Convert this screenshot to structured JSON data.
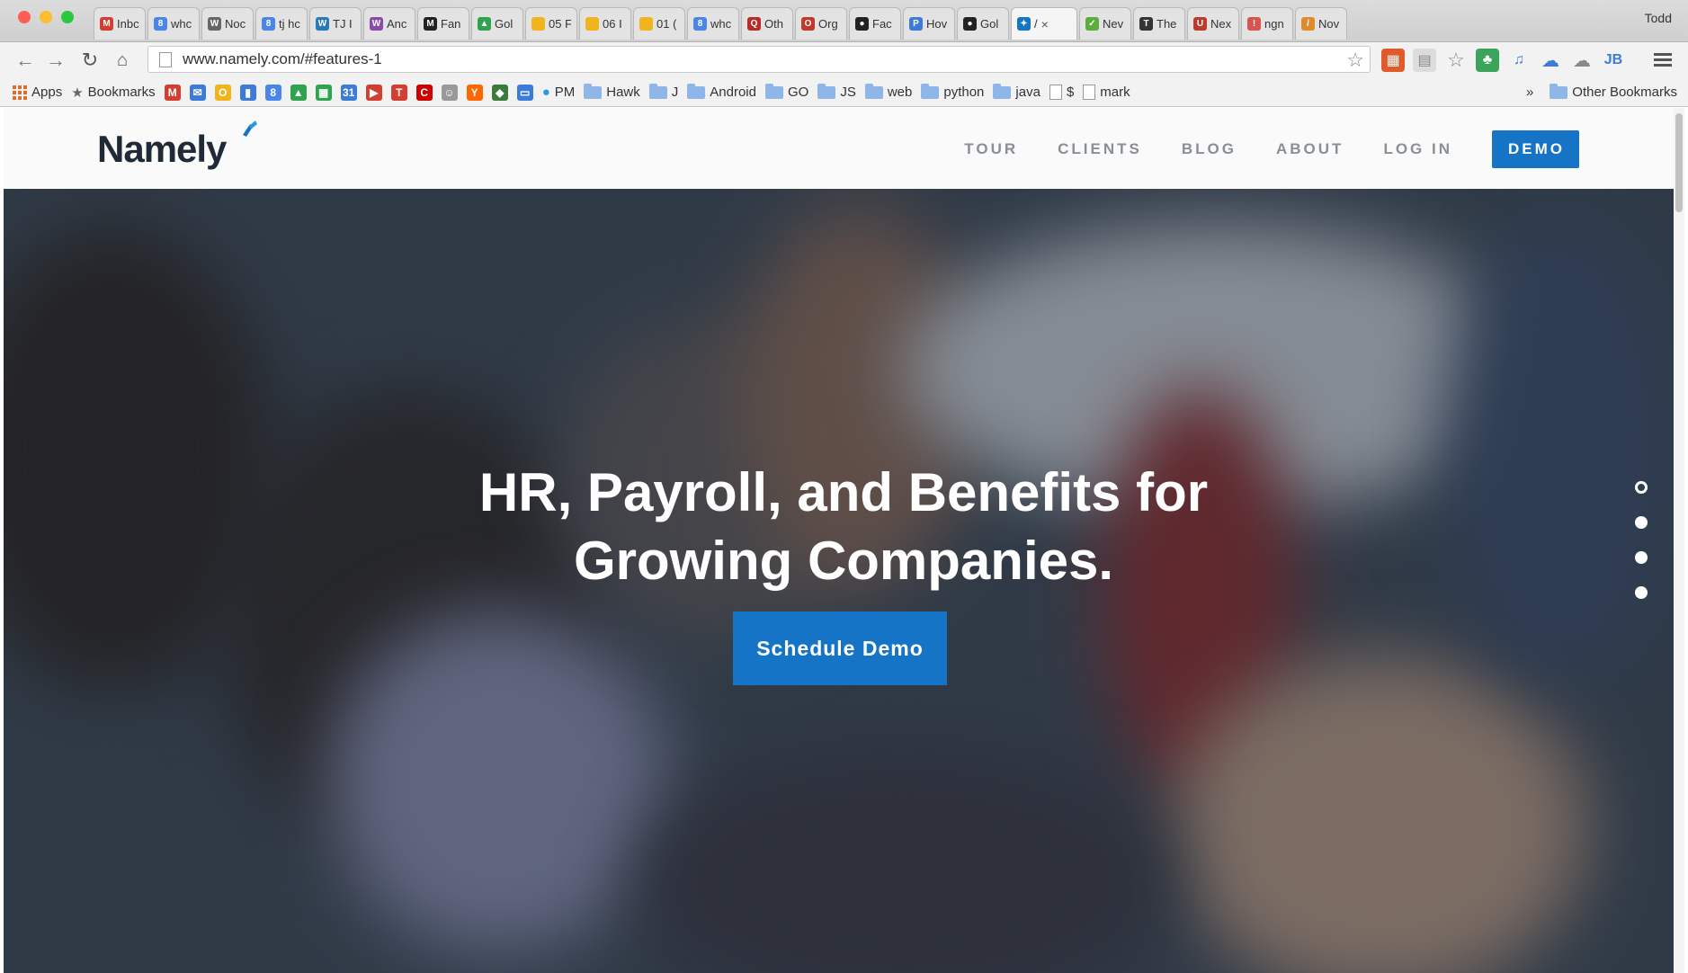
{
  "browser": {
    "profile_name": "Todd",
    "tabs": [
      {
        "title": "Inbc",
        "icon": "gmail-icon",
        "color": "#d23f31",
        "glyph": "M"
      },
      {
        "title": "whc",
        "icon": "google-icon",
        "color": "#4a86e8",
        "glyph": "8"
      },
      {
        "title": "Noc",
        "icon": "wikipedia-icon",
        "color": "#666666",
        "glyph": "W"
      },
      {
        "title": "tj hc",
        "icon": "google-icon",
        "color": "#4a86e8",
        "glyph": "8"
      },
      {
        "title": "TJ I",
        "icon": "web-icon",
        "color": "#2a7ab8",
        "glyph": "W"
      },
      {
        "title": "Anc",
        "icon": "wordpress-icon",
        "color": "#8a4aa8",
        "glyph": "W"
      },
      {
        "title": "Fan",
        "icon": "site-icon",
        "color": "#222222",
        "glyph": "M"
      },
      {
        "title": "Gol",
        "icon": "drive-icon",
        "color": "#2ea44f",
        "glyph": "▲"
      },
      {
        "title": "05 F",
        "icon": "doc-icon",
        "color": "#f0b41e",
        "glyph": ""
      },
      {
        "title": "06 I",
        "icon": "doc-icon",
        "color": "#f0b41e",
        "glyph": ""
      },
      {
        "title": "01 (",
        "icon": "doc-icon",
        "color": "#f0b41e",
        "glyph": ""
      },
      {
        "title": "whc",
        "icon": "google-icon",
        "color": "#4a86e8",
        "glyph": "8"
      },
      {
        "title": "Oth",
        "icon": "quora-icon",
        "color": "#b92b27",
        "glyph": "Q"
      },
      {
        "title": "Org",
        "icon": "site-icon",
        "color": "#c0392b",
        "glyph": "O"
      },
      {
        "title": "Fac",
        "icon": "github-icon",
        "color": "#222222",
        "glyph": "●"
      },
      {
        "title": "Hov",
        "icon": "site-icon",
        "color": "#3d7bd9",
        "glyph": "P"
      },
      {
        "title": "Gol",
        "icon": "github-icon",
        "color": "#222222",
        "glyph": "●"
      },
      {
        "title": "/",
        "icon": "namely-icon",
        "color": "#1574c6",
        "glyph": "✦",
        "active": true
      },
      {
        "title": "Nev",
        "icon": "check-icon",
        "color": "#5cae3c",
        "glyph": "✓"
      },
      {
        "title": "The",
        "icon": "nyt-icon",
        "color": "#333333",
        "glyph": "T"
      },
      {
        "title": "Nex",
        "icon": "power-icon",
        "color": "#c0392b",
        "glyph": "U"
      },
      {
        "title": "ngn",
        "icon": "site-icon",
        "color": "#d9534f",
        "glyph": "!"
      },
      {
        "title": "Nov",
        "icon": "site-icon",
        "color": "#e08a2e",
        "glyph": "/"
      }
    ],
    "url": "www.namely.com/#features-1"
  },
  "bookmarks": {
    "apps_label": "Apps",
    "bookmarks_label": "Bookmarks",
    "icons": [
      {
        "name": "gmail-bookmark-icon",
        "color": "#d23f31",
        "glyph": "M"
      },
      {
        "name": "feedly-bookmark-icon",
        "color": "#3d7bd9",
        "glyph": "✉"
      },
      {
        "name": "folder-bookmark-icon",
        "color": "#f0b41e",
        "glyph": "O"
      },
      {
        "name": "chat-bookmark-icon",
        "color": "#3d7bd9",
        "glyph": "▮"
      },
      {
        "name": "google-bookmark-icon",
        "color": "#4a86e8",
        "glyph": "8"
      },
      {
        "name": "drive-bookmark-icon",
        "color": "#2ea44f",
        "glyph": "▲"
      },
      {
        "name": "sheets-bookmark-icon",
        "color": "#2ea44f",
        "glyph": "▦"
      },
      {
        "name": "calendar-bookmark-icon",
        "color": "#3d7bd9",
        "glyph": "31"
      },
      {
        "name": "youtube-bookmark-icon",
        "color": "#d23f31",
        "glyph": "▶"
      },
      {
        "name": "t-bookmark-icon",
        "color": "#d23f31",
        "glyph": "T"
      },
      {
        "name": "cnn-bookmark-icon",
        "color": "#cc0000",
        "glyph": "C"
      },
      {
        "name": "reddit-bookmark-icon",
        "color": "#999999",
        "glyph": "☺"
      },
      {
        "name": "hackernews-bookmark-icon",
        "color": "#ff6600",
        "glyph": "Y"
      },
      {
        "name": "android-bookmark-icon",
        "color": "#3a7a3a",
        "glyph": "◆"
      },
      {
        "name": "photo-bookmark-icon",
        "color": "#3d7bd9",
        "glyph": "▭"
      }
    ],
    "items": [
      "PM",
      "Hawk",
      "J",
      "Android",
      "GO",
      "JS",
      "web",
      "python",
      "java",
      "$",
      "mark"
    ],
    "other_label": "Other Bookmarks",
    "overflow_label": "»"
  },
  "site": {
    "logo": "Namely",
    "nav": [
      "TOUR",
      "CLIENTS",
      "BLOG",
      "ABOUT",
      "LOG IN"
    ],
    "demo_button": "DEMO",
    "hero_line1": "HR, Payroll, and Benefits for",
    "hero_line2": "Growing Companies.",
    "cta": "Schedule Demo",
    "accent_color": "#1574c6"
  }
}
